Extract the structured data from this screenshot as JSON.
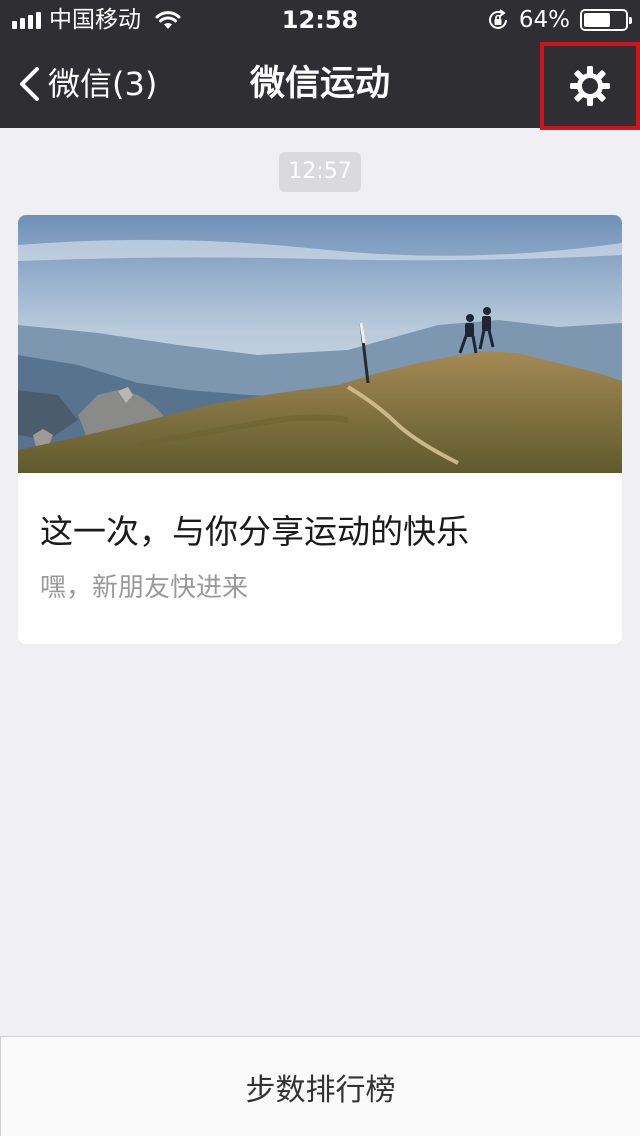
{
  "status_bar": {
    "carrier": "中国移动",
    "time": "12:58",
    "battery_percent": "64%",
    "battery_level": 0.64,
    "icons": [
      "signal-icon",
      "wifi-icon",
      "rotation-lock-icon",
      "battery-icon"
    ]
  },
  "nav": {
    "back_label": "微信(3)",
    "title": "微信运动",
    "settings_icon": "gear-icon",
    "highlight_color": "#d1131d"
  },
  "chat": {
    "timestamp": "12:57"
  },
  "card": {
    "title": "这一次，与你分享运动的快乐",
    "subtitle": "嘿，新朋友快进来"
  },
  "bottom": {
    "label": "步数排行榜"
  },
  "colors": {
    "nav_background": "#2e2e33",
    "page_background": "#efeff4"
  }
}
